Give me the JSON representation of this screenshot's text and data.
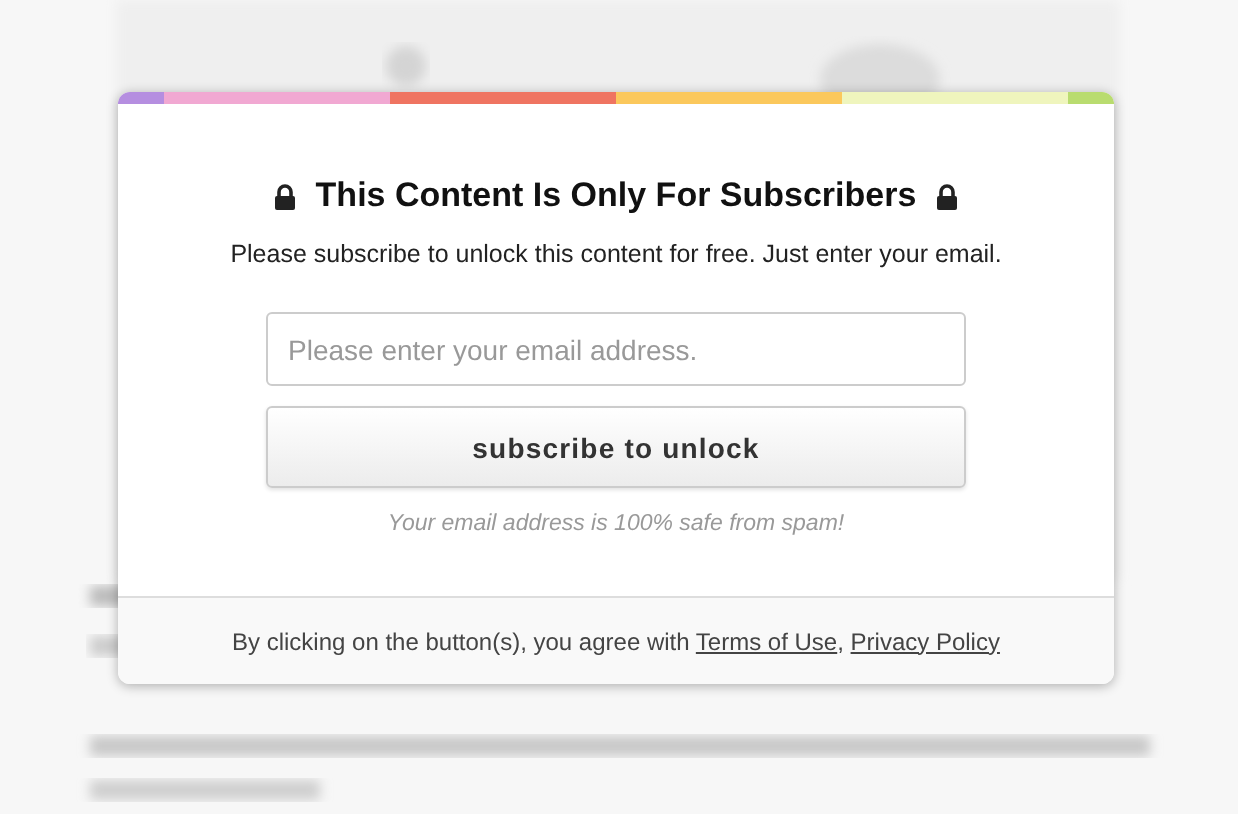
{
  "stripe": [
    {
      "color": "#b58ee0"
    },
    {
      "color": "#f1a8d2"
    },
    {
      "color": "#ef7461"
    },
    {
      "color": "#fbc85c"
    },
    {
      "color": "#eff5bd"
    },
    {
      "color": "#b9dc6f"
    }
  ],
  "modal": {
    "title": "This Content Is Only For Subscribers",
    "subtitle": "Please subscribe to unlock this content for free. Just enter your email.",
    "email_field": {
      "placeholder": "Please enter your email address."
    },
    "submit_button": "subscribe to unlock",
    "note": "Your email address is 100% safe from spam!",
    "footer": {
      "text": "By clicking on the button(s), you agree with",
      "links": [
        "Terms of Use",
        "Privacy Policy"
      ],
      "separator": ","
    }
  }
}
